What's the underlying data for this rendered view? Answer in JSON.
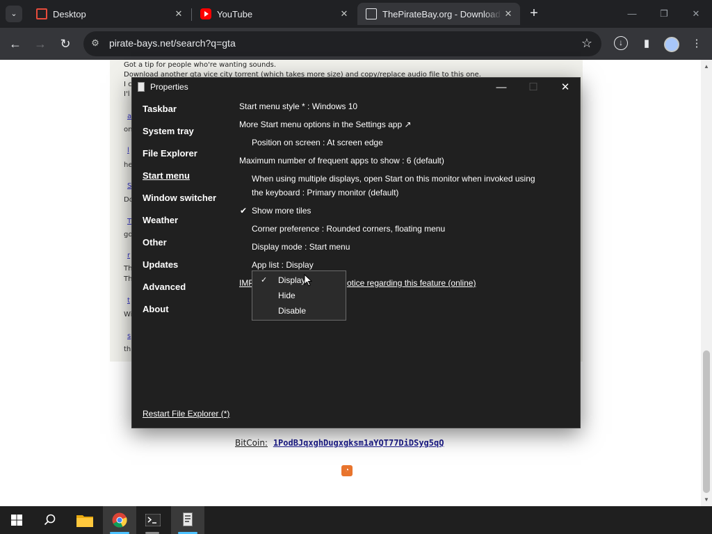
{
  "browser": {
    "tabs": [
      {
        "title": "Desktop",
        "favicon": "desktop-icon",
        "color": "#e74c3c"
      },
      {
        "title": "YouTube",
        "favicon": "youtube-icon",
        "color": "#ff0000"
      },
      {
        "title": "ThePirateBay.org - Download music, movies, games, software!",
        "favicon": "piratebay-icon",
        "color": "#e8eaed"
      }
    ],
    "tab_close": "✕",
    "new_tab": "+",
    "url": "pirate-bays.net/search?q=gta"
  },
  "page": {
    "lines": [
      "Got a tip for people who're wanting sounds.",
      "Download another gta vice city torrent (which takes more size) and copy/replace audio file to this one.",
      "I c",
      "I'l"
    ],
    "side_chars": [
      "on",
      "he",
      "Do",
      "go",
      "Th",
      "Th",
      "Wi",
      "th"
    ],
    "side_links": [
      "a",
      "l",
      "S",
      "T",
      "r",
      "t",
      "s"
    ],
    "bitcoin_label": "BitCoin:",
    "bitcoin_address": "1PodBJqxghDugxgksm1aYQT77DiDSyg5qQ"
  },
  "dialog": {
    "title": "Properties",
    "nav": [
      "Taskbar",
      "System tray",
      "File Explorer",
      "Start menu",
      "Window switcher",
      "Weather",
      "Other",
      "Updates",
      "Advanced",
      "About"
    ],
    "selected_nav": "Start menu",
    "options": {
      "start_menu_style": "Start menu style * : Windows 10",
      "more_options": "More Start menu options in the Settings app ↗",
      "position": "Position on screen : At screen edge",
      "max_frequent": "Maximum number of frequent apps to show : 6 (default)",
      "multi_display": "When using multiple displays, open Start on this monitor when invoked using the keyboard : Primary monitor (default)",
      "show_more_tiles": "Show more tiles",
      "corner_pref": "Corner preference : Rounded corners, floating menu",
      "display_mode": "Display mode : Start menu",
      "app_list": "App list : Display",
      "important_notice_pre": "IMP",
      "important_notice_post": "otice regarding this feature (online)"
    },
    "restart": "Restart File Explorer (*)",
    "dropdown": {
      "items": [
        "Display",
        "Hide",
        "Disable"
      ],
      "selected": "Display"
    }
  }
}
